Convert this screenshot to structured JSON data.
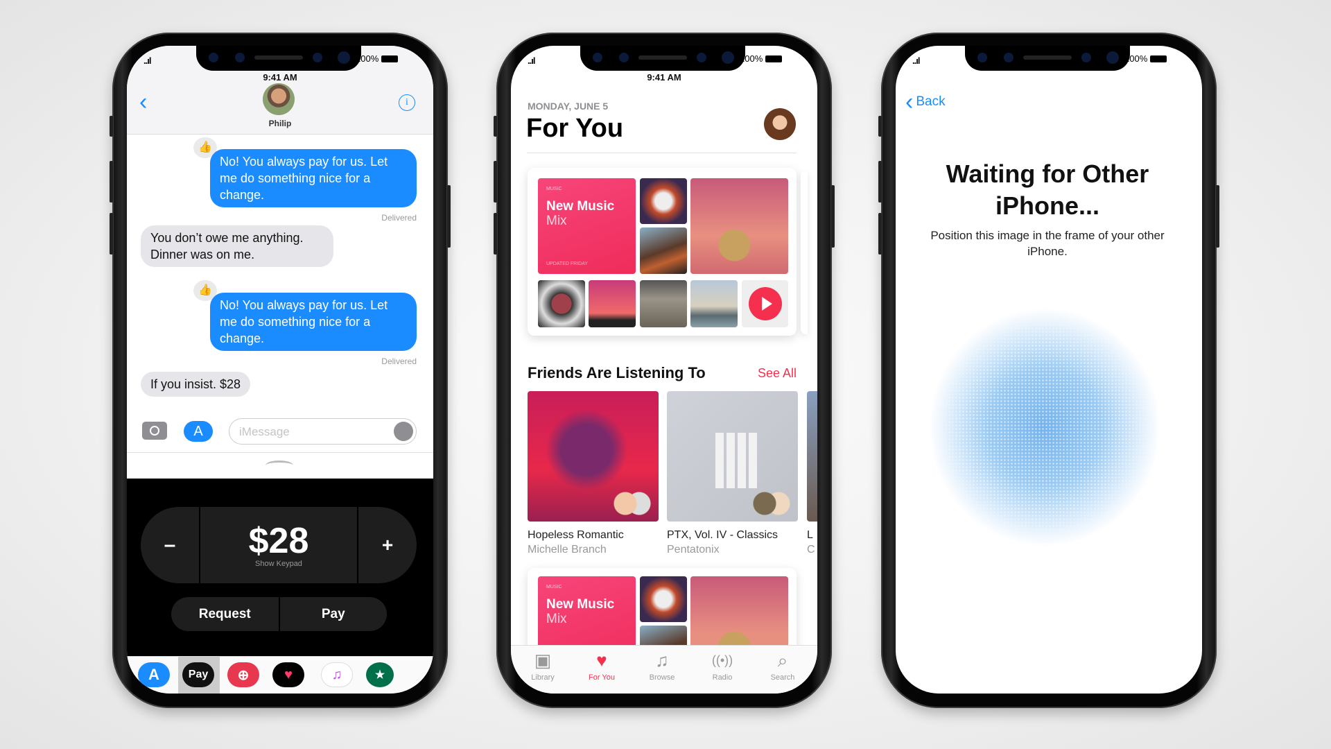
{
  "status_bar": {
    "signal": "..ıl",
    "wifi": "wifi-icon",
    "battery": "100%",
    "time": "9:41 AM"
  },
  "messages": {
    "contact_name": "Philip",
    "thread": [
      {
        "from": "me",
        "text": "No! You always pay for us. Let me do something nice for a change.",
        "status": "Delivered",
        "reaction": "thumbs-up-icon"
      },
      {
        "from": "them",
        "text": "You don’t owe me anything. Dinner was on me."
      },
      {
        "from": "me",
        "text": "No! You always pay for us. Let me do something nice for a change.",
        "status": "Delivered",
        "reaction": "thumbs-up-icon"
      },
      {
        "from": "them",
        "text": "If you insist. $28"
      }
    ],
    "input_placeholder": "iMessage",
    "apple_pay": {
      "amount": "$28",
      "minus": "–",
      "plus": "+",
      "show_keypad": "Show Keypad",
      "request": "Request",
      "pay": "Pay"
    },
    "drawer_apps": [
      {
        "name": "app-store-icon",
        "label": "A"
      },
      {
        "name": "apple-pay-icon",
        "label": "Pay"
      },
      {
        "name": "search-images-icon",
        "label": "⊕"
      },
      {
        "name": "digital-touch-icon",
        "label": "♥"
      },
      {
        "name": "music-icon",
        "label": "♫"
      },
      {
        "name": "starbucks-icon",
        "label": "★"
      }
    ],
    "colors": {
      "blue": "#1a8cff",
      "gray": "#e6e6ea"
    }
  },
  "music": {
    "date": "MONDAY, JUNE 5",
    "title": "For You",
    "mix": {
      "brand": "MUSIC",
      "title": "New Music",
      "subtitle": "Mix",
      "updated": "UPDATED FRIDAY"
    },
    "friends_heading": "Friends Are Listening To",
    "see_all": "See All",
    "albums": [
      {
        "title": "Hopeless Romantic",
        "artist": "Michelle Branch"
      },
      {
        "title": "PTX, Vol. IV - Classics",
        "artist": "Pentatonix"
      },
      {
        "title": "L",
        "artist": "C"
      }
    ],
    "tabs": [
      {
        "label": "Library",
        "icon": "library-icon",
        "active": false
      },
      {
        "label": "For You",
        "icon": "heart-icon",
        "active": true
      },
      {
        "label": "Browse",
        "icon": "music-note-icon",
        "active": false
      },
      {
        "label": "Radio",
        "icon": "radio-icon",
        "active": false
      },
      {
        "label": "Search",
        "icon": "search-icon",
        "active": false
      }
    ],
    "accent": "#f5304f"
  },
  "pairing": {
    "back": "Back",
    "title": "Waiting for Other iPhone...",
    "subtitle": "Position this image in the frame of your other iPhone."
  }
}
